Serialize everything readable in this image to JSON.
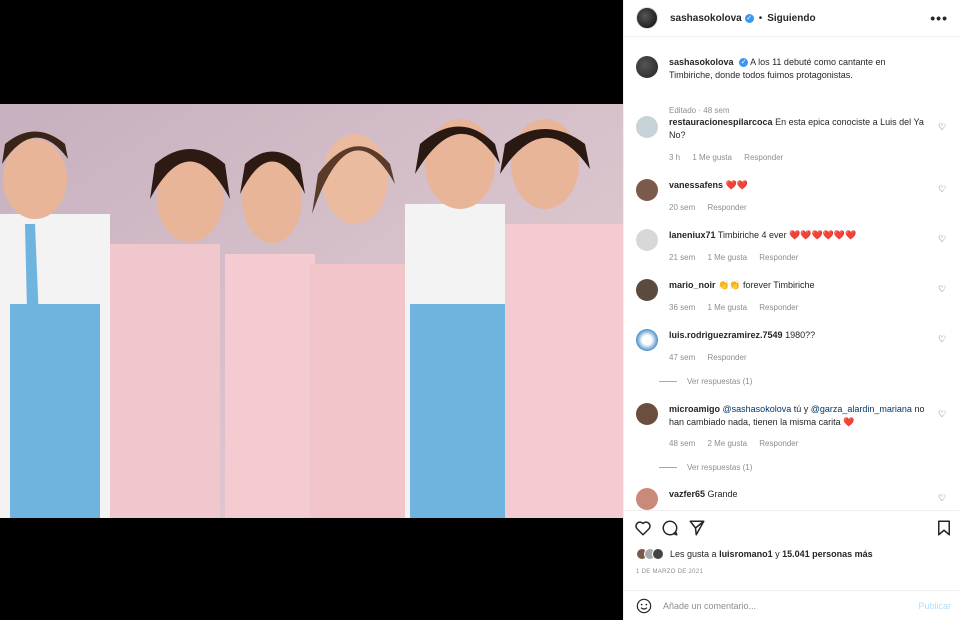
{
  "post": {
    "username": "sashasokolova",
    "follow_status": "Siguiendo",
    "separator": "•",
    "more_icon": "more-horizontal-icon"
  },
  "caption": {
    "username": "sashasokolova",
    "text": "A los 11 debuté como cantante en Timbiriche, donde todos fuimos protagonistas.",
    "meta": "Editado · 48 sem"
  },
  "comments": [
    {
      "username": "restauracionespilarcoca",
      "text": "En esta epica conociste a Luis del Ya No?",
      "time": "3 h",
      "likes": "1 Me gusta",
      "reply": "Responder"
    },
    {
      "username": "vanessafens",
      "text": "❤️❤️",
      "time": "20 sem",
      "likes": "",
      "reply": "Responder"
    },
    {
      "username": "laneniux71",
      "text": "Timbiriche 4 ever ❤️❤️❤️❤️❤️❤️",
      "time": "21 sem",
      "likes": "1 Me gusta",
      "reply": "Responder"
    },
    {
      "username": "mario_noir",
      "text": "👏👏 forever Timbiriche",
      "time": "36 sem",
      "likes": "1 Me gusta",
      "reply": "Responder"
    },
    {
      "username": "luis.rodriguezramirez.7549",
      "text": "1980??",
      "time": "47 sem",
      "likes": "",
      "reply": "Responder",
      "view_replies": "Ver respuestas (1)"
    },
    {
      "username": "microamigo",
      "mention1": "@sashasokolova",
      "mid": " tú y ",
      "mention2": "@garza_alardin_mariana",
      "text": " no han cambiado nada, tienen la misma carita ❤️",
      "time": "48 sem",
      "likes": "2 Me gusta",
      "reply": "Responder",
      "view_replies": "Ver respuestas (1)"
    },
    {
      "username": "vazfer65",
      "text": "Grande"
    }
  ],
  "likes": {
    "prefix": "Les gusta a",
    "user": "luisromano1",
    "conj": "y",
    "count": "15.041 personas más"
  },
  "date": "1 DE MARZO DE 2021",
  "add_comment": {
    "placeholder": "Añade un comentario...",
    "post_label": "Publicar"
  },
  "colors": {
    "accent": "#0095f6",
    "verified": "#3897f0",
    "heart_red": "#ed4956"
  }
}
